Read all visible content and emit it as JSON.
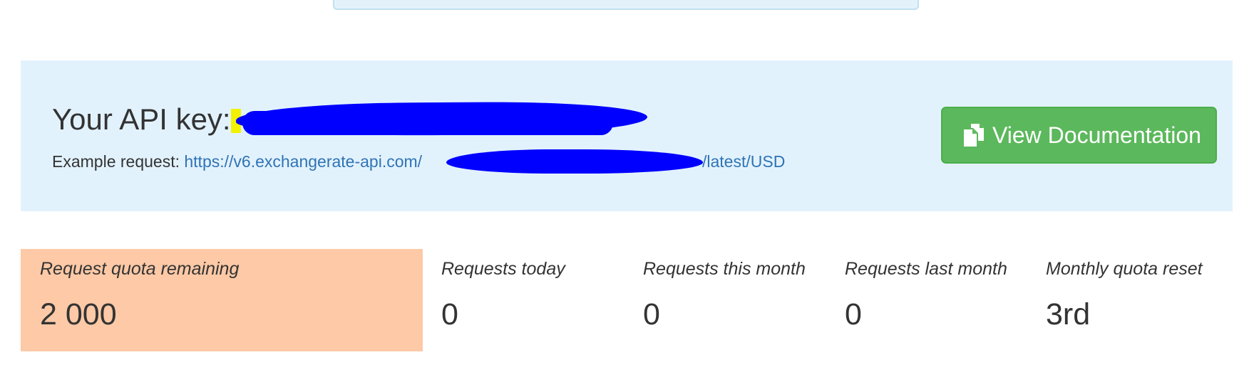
{
  "api_panel": {
    "title": "Your API key:",
    "example_label": "Example request: ",
    "example_url_prefix": "https://v6.exchangerate-api.com/",
    "example_url_suffix": "/latest/USD",
    "doc_button_label": "View Documentation",
    "doc_button_icon": "files-icon",
    "background_color": "#e2f2fd",
    "button_color": "#5cb85c"
  },
  "stats": [
    {
      "label": "Request quota remaining",
      "value": "2 000",
      "highlight": true
    },
    {
      "label": "Requests today",
      "value": "0"
    },
    {
      "label": "Requests this month",
      "value": "0"
    },
    {
      "label": "Requests last month",
      "value": "0"
    },
    {
      "label": "Monthly quota reset",
      "value": "3rd"
    }
  ],
  "colors": {
    "highlight_stat": "#fdc9a6",
    "link": "#2f74b5",
    "redaction": "#0000ff"
  }
}
